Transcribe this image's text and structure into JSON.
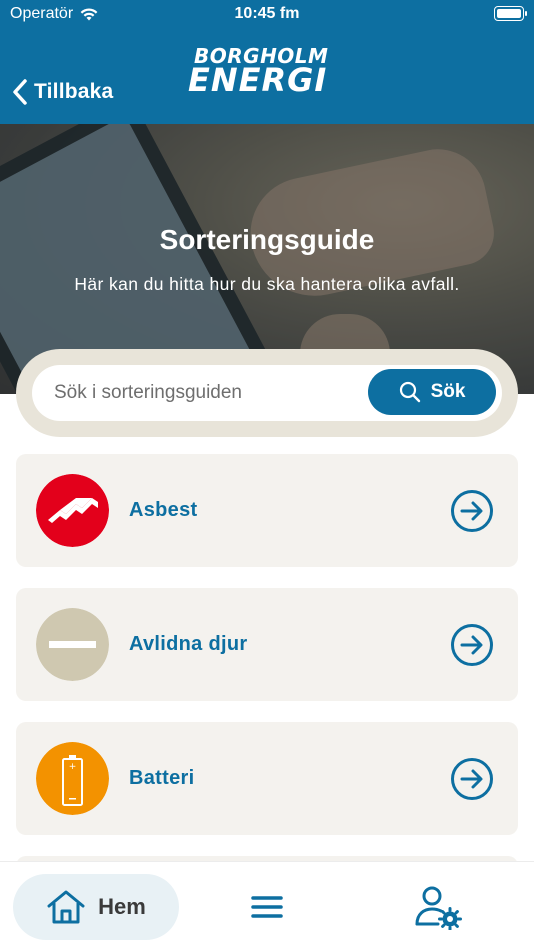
{
  "status_bar": {
    "carrier": "Operatör",
    "time": "10:45 fm"
  },
  "header": {
    "back_label": "Tillbaka",
    "logo_top": "BORGHOLM",
    "logo_bottom": "ENERGI",
    "background_color": "#0d6fa1"
  },
  "hero": {
    "title": "Sorteringsguide",
    "subtitle": "Här kan du hitta hur du ska hantera olika avfall."
  },
  "search": {
    "placeholder": "Sök i sorteringsguiden",
    "value": "",
    "button_label": "Sök"
  },
  "categories": [
    {
      "label": "Asbest",
      "icon": "asbestos-roof-icon",
      "icon_color": "#e3001b"
    },
    {
      "label": "Avlidna djur",
      "icon": "minus-icon",
      "icon_color": "#cfc8b0"
    },
    {
      "label": "Batteri",
      "icon": "battery-icon",
      "icon_color": "#f39200"
    }
  ],
  "tabbar": {
    "home_label": "Hem",
    "menu_icon": "hamburger-menu-icon",
    "account_icon": "user-settings-icon"
  },
  "colors": {
    "brand": "#0d6fa1",
    "card_bg": "#f4f2ee",
    "search_ring": "#e8e4d9"
  }
}
